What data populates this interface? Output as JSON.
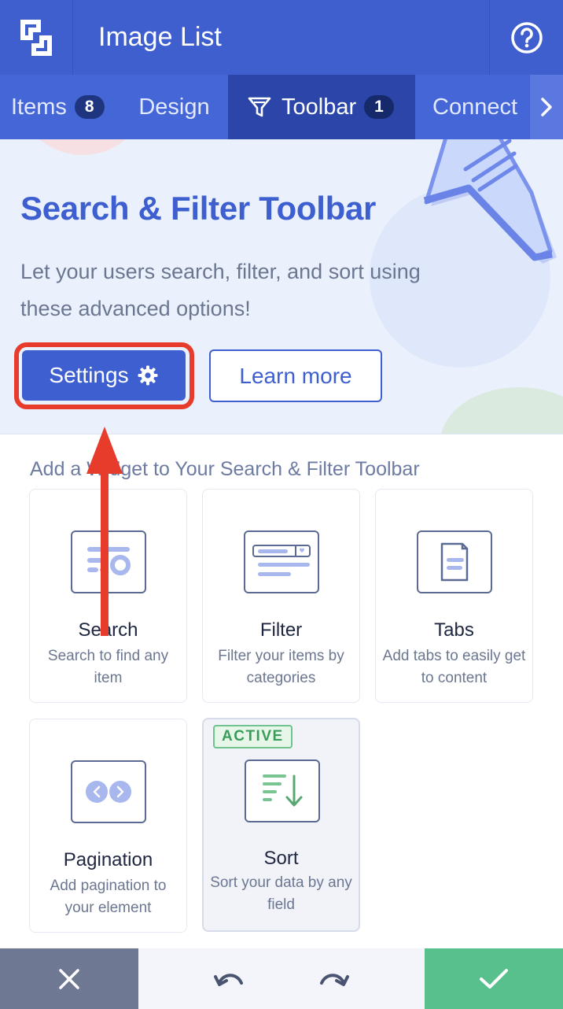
{
  "header": {
    "title": "Image List"
  },
  "tabs": [
    {
      "label": "Items",
      "badge": "8"
    },
    {
      "label": "Design"
    },
    {
      "label": "Toolbar",
      "badge": "1"
    },
    {
      "label": "Connect"
    }
  ],
  "hero": {
    "title": "Search & Filter Toolbar",
    "subtitle": "Let your users search, filter, and sort using these advanced options!",
    "settings_label": "Settings",
    "learn_more_label": "Learn more"
  },
  "widgets": {
    "section_title": "Add a Widget to Your Search & Filter Toolbar",
    "items": [
      {
        "title": "Search",
        "desc": "Search to find any item"
      },
      {
        "title": "Filter",
        "desc": "Filter your items by categories"
      },
      {
        "title": "Tabs",
        "desc": "Add tabs to easily get to content"
      },
      {
        "title": "Pagination",
        "desc": "Add pagination to your element"
      },
      {
        "title": "Sort",
        "desc": "Sort your data by any field",
        "badge": "ACTIVE"
      }
    ]
  },
  "colors": {
    "primary": "#3d5fcf",
    "header": "#3f5fcf",
    "highlight": "#e73b2c",
    "confirm": "#58c08c",
    "cancel": "#6e7892"
  }
}
